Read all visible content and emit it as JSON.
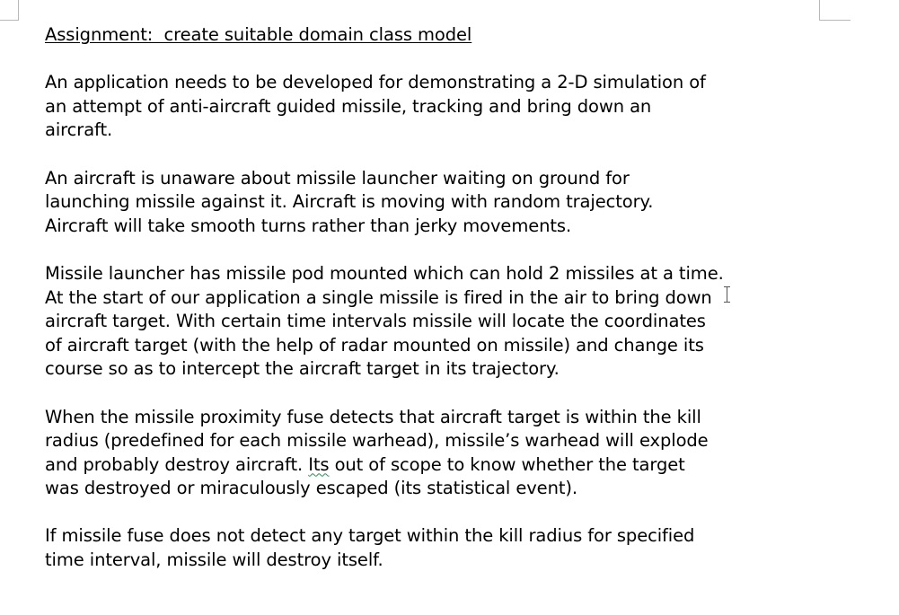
{
  "document": {
    "heading": "Assignment:  create suitable domain class model",
    "paragraphs": [
      {
        "lines": [
          "An application needs to be developed for demonstrating a 2-D simulation of",
          "an attempt of anti-aircraft guided missile, tracking and bring down an",
          "aircraft."
        ]
      },
      {
        "lines": [
          "An aircraft is unaware about missile launcher waiting on ground for",
          "launching missile against it. Aircraft is moving with random trajectory.",
          "Aircraft will take smooth turns rather than jerky movements."
        ]
      },
      {
        "lines": [
          "Missile launcher has missile pod mounted which can hold 2 missiles at a time.",
          "At the start of our application a single missile is fired in the air to bring down",
          "aircraft target. With certain time intervals missile will locate the coordinates",
          "of aircraft target (with the help of radar mounted on missile) and change its",
          "course so as to intercept the aircraft target in its trajectory."
        ]
      },
      {
        "lines": [
          "When the missile proximity fuse detects that aircraft target is within the kill",
          "radius (predefined for each missile warhead), missile’s warhead will explode",
          {
            "before": "and probably destroy aircraft. ",
            "flagged": "Its",
            "after": " out of scope to know whether the target"
          },
          "was destroyed or miraculously escaped (its statistical event)."
        ]
      },
      {
        "lines": [
          "If missile fuse does not detect any target within the kill radius for specified",
          "time interval, missile will destroy itself."
        ]
      }
    ]
  },
  "colors": {
    "text": "#000000",
    "page_background": "#ffffff",
    "spellcheck_underline": "#2e8b57",
    "margin_marks": "#b8b8b8"
  }
}
